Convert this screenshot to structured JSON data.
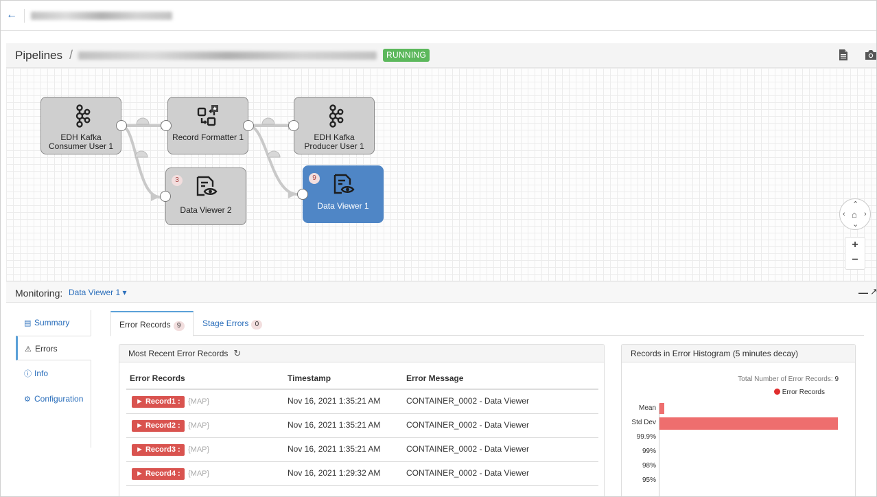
{
  "topbar": {
    "back_icon": "arrow-left-icon"
  },
  "header": {
    "breadcrumb_root": "Pipelines",
    "breadcrumb_sep": "/",
    "status": "RUNNING",
    "status_color": "#5cb85c"
  },
  "pipeline": {
    "nodes": [
      {
        "id": "kafka-consumer",
        "label": "EDH Kafka Consumer User 1",
        "icon": "kafka-icon"
      },
      {
        "id": "record-formatter",
        "label": "Record Formatter 1",
        "icon": "formatter-icon"
      },
      {
        "id": "kafka-producer",
        "label": "EDH Kafka Producer User 1",
        "icon": "kafka-icon"
      },
      {
        "id": "data-viewer-2",
        "label": "Data Viewer 2",
        "icon": "data-viewer-icon",
        "count": "3"
      },
      {
        "id": "data-viewer-1",
        "label": "Data Viewer 1",
        "icon": "data-viewer-icon",
        "count": "9",
        "selected": true
      }
    ],
    "accent": "#4f86c6"
  },
  "zoom": {
    "plus": "+",
    "minus": "−"
  },
  "monitoring": {
    "label": "Monitoring:",
    "selected_stage": "Data Viewer 1 ▾"
  },
  "left_tabs": [
    {
      "label": "Summary",
      "icon": "bar-chart-icon"
    },
    {
      "label": "Errors",
      "icon": "warning-icon",
      "active": true
    },
    {
      "label": "Info",
      "icon": "info-icon"
    },
    {
      "label": "Configuration",
      "icon": "gear-icon"
    }
  ],
  "right_tabs": [
    {
      "label": "Error Records",
      "count": "9",
      "active": true
    },
    {
      "label": "Stage Errors",
      "count": "0"
    }
  ],
  "error_panel": {
    "title": "Most Recent Error Records",
    "columns": [
      "Error Records",
      "Timestamp",
      "Error Message"
    ],
    "rows": [
      {
        "record": "► Record1 :",
        "map": "{MAP}",
        "timestamp": "Nov 16, 2021 1:35:21 AM",
        "message": "CONTAINER_0002 - Data Viewer"
      },
      {
        "record": "► Record2 :",
        "map": "{MAP}",
        "timestamp": "Nov 16, 2021 1:35:21 AM",
        "message": "CONTAINER_0002 - Data Viewer"
      },
      {
        "record": "► Record3 :",
        "map": "{MAP}",
        "timestamp": "Nov 16, 2021 1:35:21 AM",
        "message": "CONTAINER_0002 - Data Viewer"
      },
      {
        "record": "► Record4 :",
        "map": "{MAP}",
        "timestamp": "Nov 16, 2021 1:29:32 AM",
        "message": "CONTAINER_0002 - Data Viewer"
      }
    ]
  },
  "histogram": {
    "title": "Records in Error Histogram (5 minutes decay)",
    "total_label": "Total Number of Error Records:",
    "total_value": "9",
    "legend": "Error Records",
    "legend_color": "#e02d2d",
    "labels": [
      "Mean",
      "Std Dev",
      "99.9%",
      "99%",
      "98%",
      "95%"
    ]
  }
}
